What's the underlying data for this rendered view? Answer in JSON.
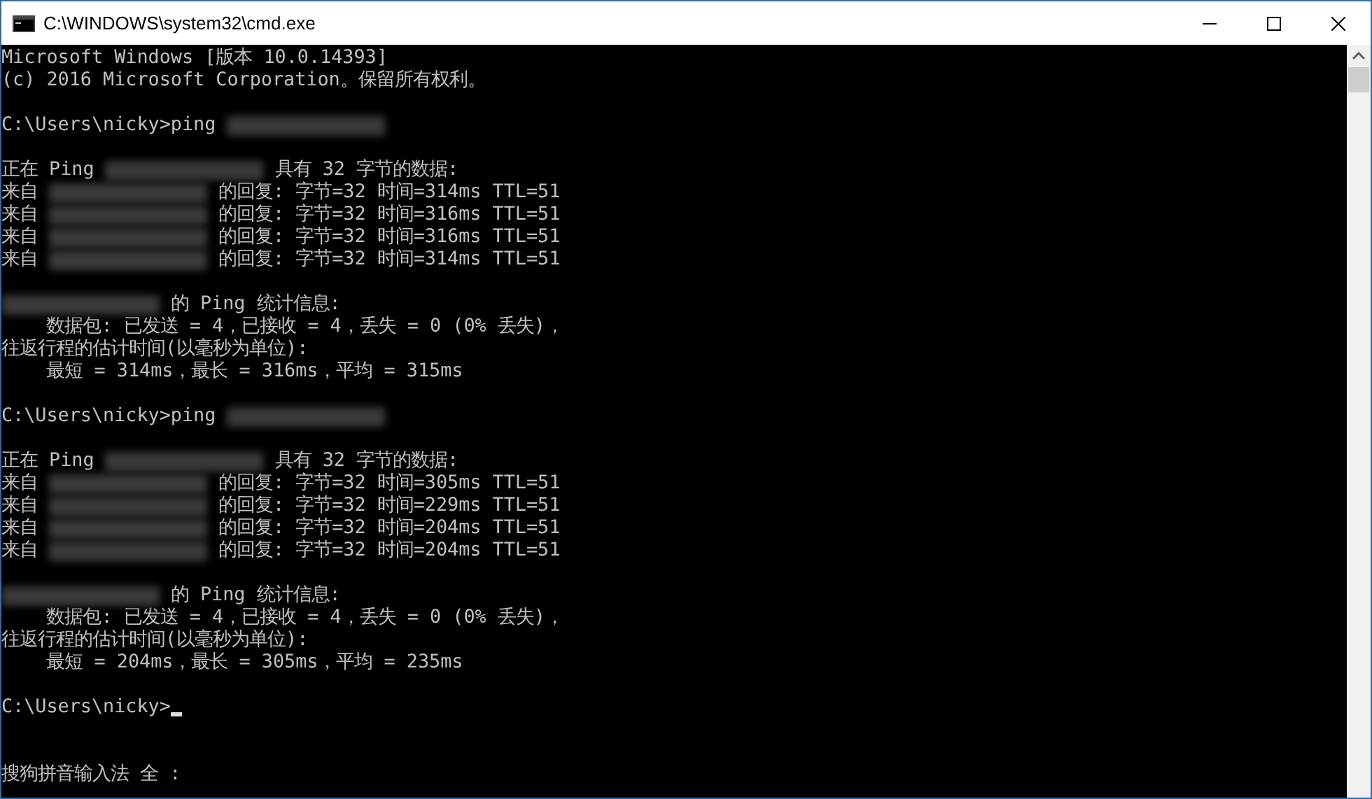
{
  "window": {
    "title": "C:\\WINDOWS\\system32\\cmd.exe"
  },
  "console": {
    "lines": [
      {
        "kind": "line",
        "segments": [
          {
            "kind": "text",
            "text": "Microsoft Windows [版本 10.0.14393]"
          }
        ]
      },
      {
        "kind": "line",
        "segments": [
          {
            "kind": "text",
            "text": "(c) 2016 Microsoft Corporation。保留所有权利。"
          }
        ]
      },
      {
        "kind": "blank"
      },
      {
        "kind": "line",
        "segments": [
          {
            "kind": "text",
            "text": "C:\\Users\\nicky>ping "
          },
          {
            "kind": "blur"
          }
        ]
      },
      {
        "kind": "blank"
      },
      {
        "kind": "line",
        "segments": [
          {
            "kind": "text",
            "text": "正在 Ping "
          },
          {
            "kind": "blur"
          },
          {
            "kind": "text",
            "text": " 具有 32 字节的数据:"
          }
        ]
      },
      {
        "kind": "line",
        "segments": [
          {
            "kind": "text",
            "text": "来自 "
          },
          {
            "kind": "blur"
          },
          {
            "kind": "text",
            "text": " 的回复: 字节=32 时间=314ms TTL=51"
          }
        ]
      },
      {
        "kind": "line",
        "segments": [
          {
            "kind": "text",
            "text": "来自 "
          },
          {
            "kind": "blur"
          },
          {
            "kind": "text",
            "text": " 的回复: 字节=32 时间=316ms TTL=51"
          }
        ]
      },
      {
        "kind": "line",
        "segments": [
          {
            "kind": "text",
            "text": "来自 "
          },
          {
            "kind": "blur"
          },
          {
            "kind": "text",
            "text": " 的回复: 字节=32 时间=316ms TTL=51"
          }
        ]
      },
      {
        "kind": "line",
        "segments": [
          {
            "kind": "text",
            "text": "来自 "
          },
          {
            "kind": "blur"
          },
          {
            "kind": "text",
            "text": " 的回复: 字节=32 时间=314ms TTL=51"
          }
        ]
      },
      {
        "kind": "blank"
      },
      {
        "kind": "line",
        "segments": [
          {
            "kind": "blur"
          },
          {
            "kind": "text",
            "text": " 的 Ping 统计信息:"
          }
        ]
      },
      {
        "kind": "line",
        "segments": [
          {
            "kind": "text",
            "text": "    数据包: 已发送 = 4，已接收 = 4，丢失 = 0 (0% 丢失)，"
          }
        ]
      },
      {
        "kind": "line",
        "segments": [
          {
            "kind": "text",
            "text": "往返行程的估计时间(以毫秒为单位):"
          }
        ]
      },
      {
        "kind": "line",
        "segments": [
          {
            "kind": "text",
            "text": "    最短 = 314ms，最长 = 316ms，平均 = 315ms"
          }
        ]
      },
      {
        "kind": "blank"
      },
      {
        "kind": "line",
        "segments": [
          {
            "kind": "text",
            "text": "C:\\Users\\nicky>ping "
          },
          {
            "kind": "blur"
          }
        ]
      },
      {
        "kind": "blank"
      },
      {
        "kind": "line",
        "segments": [
          {
            "kind": "text",
            "text": "正在 Ping "
          },
          {
            "kind": "blur"
          },
          {
            "kind": "text",
            "text": " 具有 32 字节的数据:"
          }
        ]
      },
      {
        "kind": "line",
        "segments": [
          {
            "kind": "text",
            "text": "来自 "
          },
          {
            "kind": "blur"
          },
          {
            "kind": "text",
            "text": " 的回复: 字节=32 时间=305ms TTL=51"
          }
        ]
      },
      {
        "kind": "line",
        "segments": [
          {
            "kind": "text",
            "text": "来自 "
          },
          {
            "kind": "blur"
          },
          {
            "kind": "text",
            "text": " 的回复: 字节=32 时间=229ms TTL=51"
          }
        ]
      },
      {
        "kind": "line",
        "segments": [
          {
            "kind": "text",
            "text": "来自 "
          },
          {
            "kind": "blur"
          },
          {
            "kind": "text",
            "text": " 的回复: 字节=32 时间=204ms TTL=51"
          }
        ]
      },
      {
        "kind": "line",
        "segments": [
          {
            "kind": "text",
            "text": "来自 "
          },
          {
            "kind": "blur"
          },
          {
            "kind": "text",
            "text": " 的回复: 字节=32 时间=204ms TTL=51"
          }
        ]
      },
      {
        "kind": "blank"
      },
      {
        "kind": "line",
        "segments": [
          {
            "kind": "blur"
          },
          {
            "kind": "text",
            "text": " 的 Ping 统计信息:"
          }
        ]
      },
      {
        "kind": "line",
        "segments": [
          {
            "kind": "text",
            "text": "    数据包: 已发送 = 4，已接收 = 4，丢失 = 0 (0% 丢失)，"
          }
        ]
      },
      {
        "kind": "line",
        "segments": [
          {
            "kind": "text",
            "text": "往返行程的估计时间(以毫秒为单位):"
          }
        ]
      },
      {
        "kind": "line",
        "segments": [
          {
            "kind": "text",
            "text": "    最短 = 204ms，最长 = 305ms，平均 = 235ms"
          }
        ]
      },
      {
        "kind": "blank"
      },
      {
        "kind": "line",
        "segments": [
          {
            "kind": "text",
            "text": "C:\\Users\\nicky>"
          },
          {
            "kind": "cursor"
          }
        ]
      },
      {
        "kind": "blank"
      },
      {
        "kind": "blank"
      },
      {
        "kind": "line",
        "segments": [
          {
            "kind": "text",
            "text": "搜狗拼音输入法 全 :"
          }
        ]
      }
    ]
  }
}
